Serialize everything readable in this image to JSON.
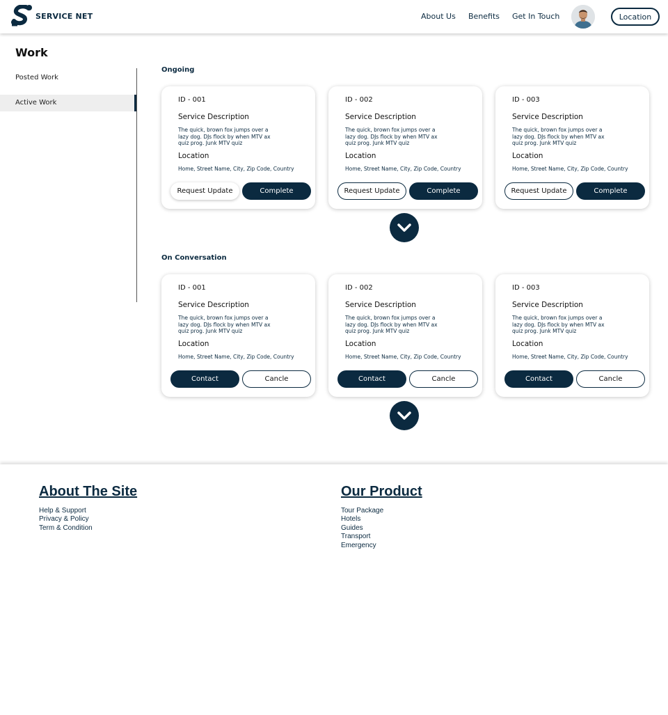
{
  "header": {
    "brand": "SERVICE NET",
    "nav": [
      "About Us",
      "Benefits",
      "Get In Touch"
    ],
    "location_button": "Location"
  },
  "sidebar": {
    "title": "Work",
    "items": [
      {
        "label": "Posted Work",
        "active": false
      },
      {
        "label": "Active Work",
        "active": true
      }
    ]
  },
  "ongoing": {
    "title": "Ongoing",
    "cards": [
      {
        "id": "ID - 001",
        "service_heading": "Service Description",
        "description": "The quick, brown fox jumps over a lazy dog. DJs flock by when MTV ax quiz prog. Junk MTV quiz",
        "location_heading": "Location",
        "address": "Home, Street Name, City, Zip Code, Country",
        "button_left": "Request Update",
        "button_right": "Complete"
      },
      {
        "id": "ID - 002",
        "service_heading": "Service Description",
        "description": "The quick, brown fox jumps over a lazy dog. DJs flock by when MTV ax quiz prog. Junk MTV quiz",
        "location_heading": "Location",
        "address": "Home, Street Name, City, Zip Code, Country",
        "button_left": "Request Update",
        "button_right": "Complete"
      },
      {
        "id": "ID - 003",
        "service_heading": "Service Description",
        "description": "The quick, brown fox jumps over a lazy dog. DJs flock by when MTV ax quiz prog. Junk MTV quiz",
        "location_heading": "Location",
        "address": "Home, Street Name, City, Zip Code, Country",
        "button_left": "Request Update",
        "button_right": "Complete"
      }
    ]
  },
  "conversation": {
    "title": "On Conversation",
    "cards": [
      {
        "id": "ID - 001",
        "service_heading": "Service Description",
        "description": "The quick, brown fox jumps over a lazy dog. DJs flock by when MTV ax quiz prog. Junk MTV quiz",
        "location_heading": "Location",
        "address": "Home, Street Name, City, Zip Code, Country",
        "button_left": "Contact",
        "button_right": "Cancle"
      },
      {
        "id": "ID - 002",
        "service_heading": "Service Description",
        "description": "The quick, brown fox jumps over a lazy dog. DJs flock by when MTV ax quiz prog. Junk MTV quiz",
        "location_heading": "Location",
        "address": "Home, Street Name, City, Zip Code, Country",
        "button_left": "Contact",
        "button_right": "Cancle"
      },
      {
        "id": "ID - 003",
        "service_heading": "Service Description",
        "description": "The quick, brown fox jumps over a lazy dog. DJs flock by when MTV ax quiz prog. Junk MTV quiz",
        "location_heading": "Location",
        "address": "Home, Street Name, City, Zip Code, Country",
        "button_left": "Contact",
        "button_right": "Cancle"
      }
    ]
  },
  "footer": {
    "about": {
      "title": "About The Site",
      "links": [
        "Help & Support",
        "Privacy & Policy",
        "Term & Condition"
      ]
    },
    "product": {
      "title": "Our Product",
      "links": [
        "Tour Package",
        "Hotels",
        "Guides",
        "Transport",
        "Emergency"
      ]
    }
  },
  "colors": {
    "primary": "#0b2a40",
    "sidebar_active_bg": "#eeeeee"
  },
  "icons": {
    "logo": "service-net-logo",
    "expand": "chevron-down-icon",
    "avatar": "user-avatar"
  }
}
